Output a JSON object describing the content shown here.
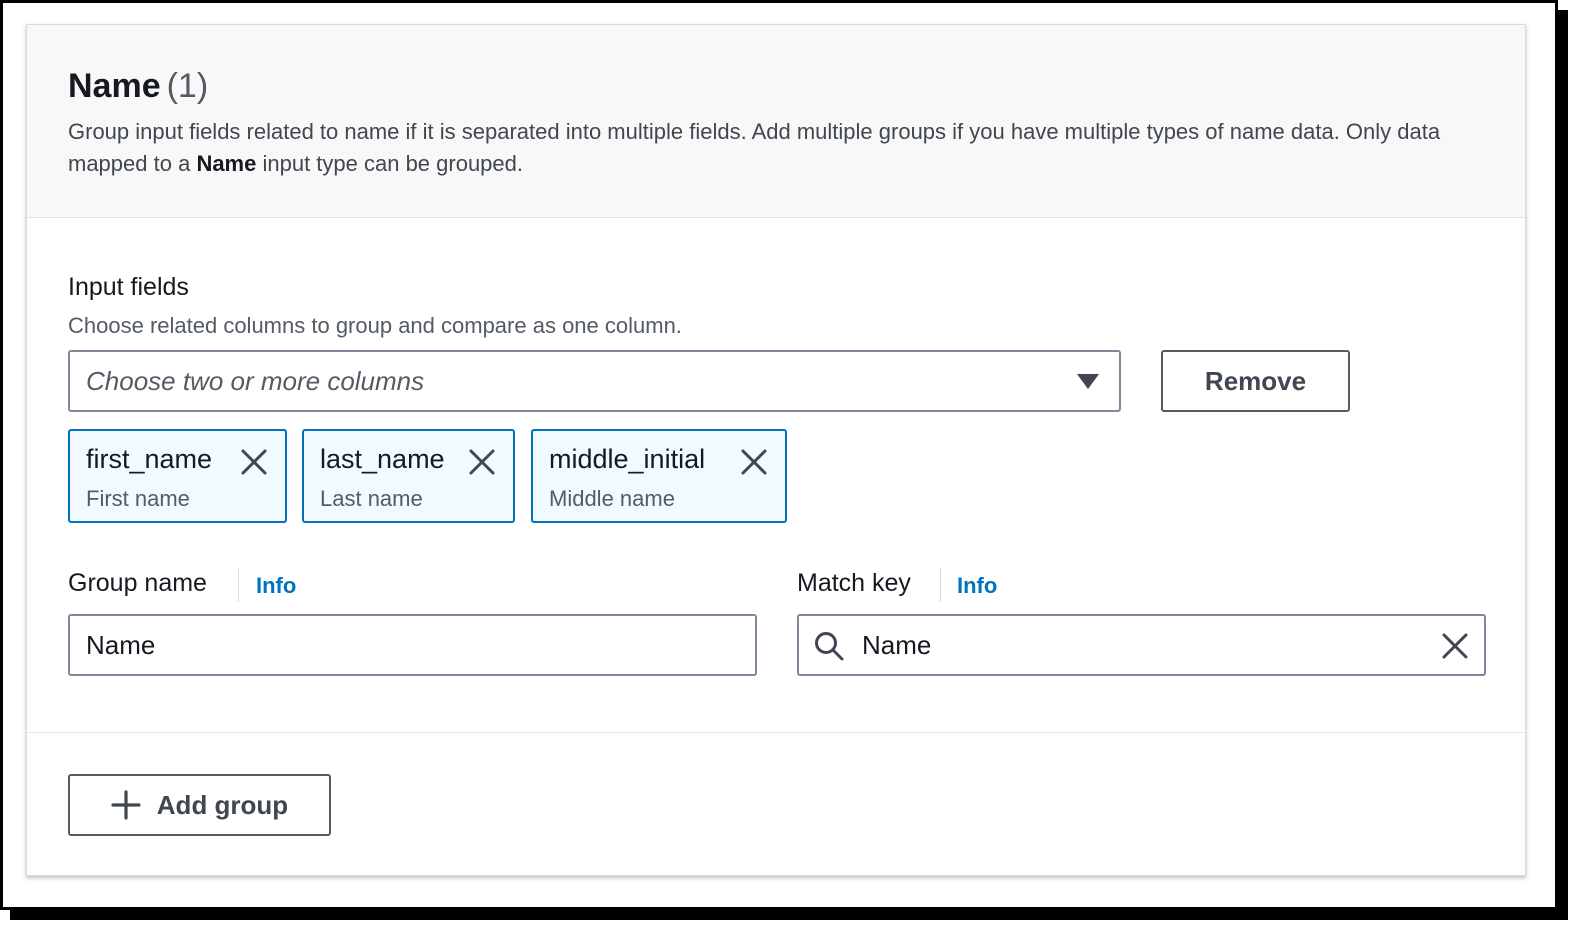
{
  "section": {
    "title": "Name",
    "count": "(1)",
    "description_before": "Group input fields related to name if it is separated into multiple fields. Add multiple groups if you have multiple types of name data. Only data mapped to a ",
    "description_bold": "Name",
    "description_after": " input type can be grouped."
  },
  "input_fields": {
    "label": "Input fields",
    "description": "Choose related columns to group and compare as one column.",
    "placeholder": "Choose two or more columns",
    "dropdown_icon": "caret-down-icon",
    "remove_label": "Remove",
    "tokens": [
      {
        "name": "first_name",
        "description": "First name",
        "icon": "close-icon"
      },
      {
        "name": "last_name",
        "description": "Last name",
        "icon": "close-icon"
      },
      {
        "name": "middle_initial",
        "description": "Middle name",
        "icon": "close-icon"
      }
    ]
  },
  "group_name": {
    "label": "Group name",
    "info": "Info",
    "value": "Name"
  },
  "match_key": {
    "label": "Match key",
    "info": "Info",
    "value": "Name",
    "search_icon": "search-icon",
    "clear_icon": "close-icon"
  },
  "footer": {
    "add_group_label": "Add group",
    "add_icon": "plus-icon"
  },
  "colors": {
    "accent": "#0073bb",
    "token_background": "#f1faff",
    "header_background": "#f8f8f8",
    "text": "#16191f"
  }
}
